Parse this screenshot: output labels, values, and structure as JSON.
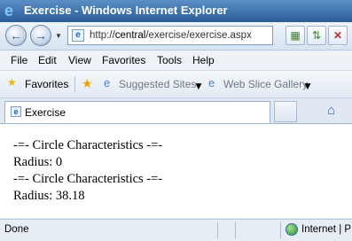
{
  "window": {
    "title": "Exercise - Windows Internet Explorer"
  },
  "address": {
    "url_prefix": "http://",
    "url_host": "central",
    "url_path": "/exercise/exercise.aspx"
  },
  "menu": [
    "File",
    "Edit",
    "View",
    "Favorites",
    "Tools",
    "Help"
  ],
  "favorites": {
    "label": "Favorites",
    "suggested": "Suggested Sites",
    "webslice": "Web Slice Gallery"
  },
  "tab": {
    "label": "Exercise"
  },
  "content": {
    "lines": [
      "-=- Circle Characteristics -=-",
      "Radius: 0",
      "-=- Circle Characteristics -=-",
      "Radius: 38.18"
    ]
  },
  "status": {
    "text": "Done",
    "zone": "Internet | P"
  }
}
